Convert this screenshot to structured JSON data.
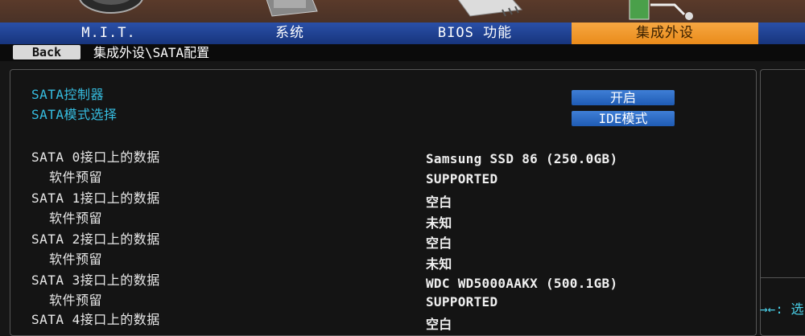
{
  "tabs": [
    {
      "label": "M.I.T.",
      "active": false
    },
    {
      "label": "系统",
      "active": false
    },
    {
      "label": "BIOS 功能",
      "active": false
    },
    {
      "label": "集成外设",
      "active": true
    }
  ],
  "breadcrumb": {
    "back_label": "Back",
    "path": "集成外设\\SATA配置"
  },
  "settings": [
    {
      "label": "SATA控制器",
      "value": "开启"
    },
    {
      "label": "SATA模式选择",
      "value": "IDE模式"
    }
  ],
  "ports": [
    {
      "label": "SATA 0接口上的数据",
      "value": "Samsung SSD 86 (250.0GB)"
    },
    {
      "label": "软件预留",
      "value": "SUPPORTED"
    },
    {
      "label": "SATA 1接口上的数据",
      "value": "空白"
    },
    {
      "label": "软件预留",
      "value": "未知"
    },
    {
      "label": "SATA 2接口上的数据",
      "value": "空白"
    },
    {
      "label": "软件预留",
      "value": "未知"
    },
    {
      "label": "SATA 3接口上的数据",
      "value": "WDC WD5000AAKX (500.1GB)"
    },
    {
      "label": "软件预留",
      "value": "SUPPORTED"
    },
    {
      "label": "SATA 4接口上的数据",
      "value": "空白"
    }
  ],
  "help": {
    "text": "→←: 选"
  },
  "colors": {
    "tab_bar": "#1f45a0",
    "active_tab": "#f09a2a",
    "option_button": "#2a6cc8",
    "cyan_text": "#36bde0"
  }
}
